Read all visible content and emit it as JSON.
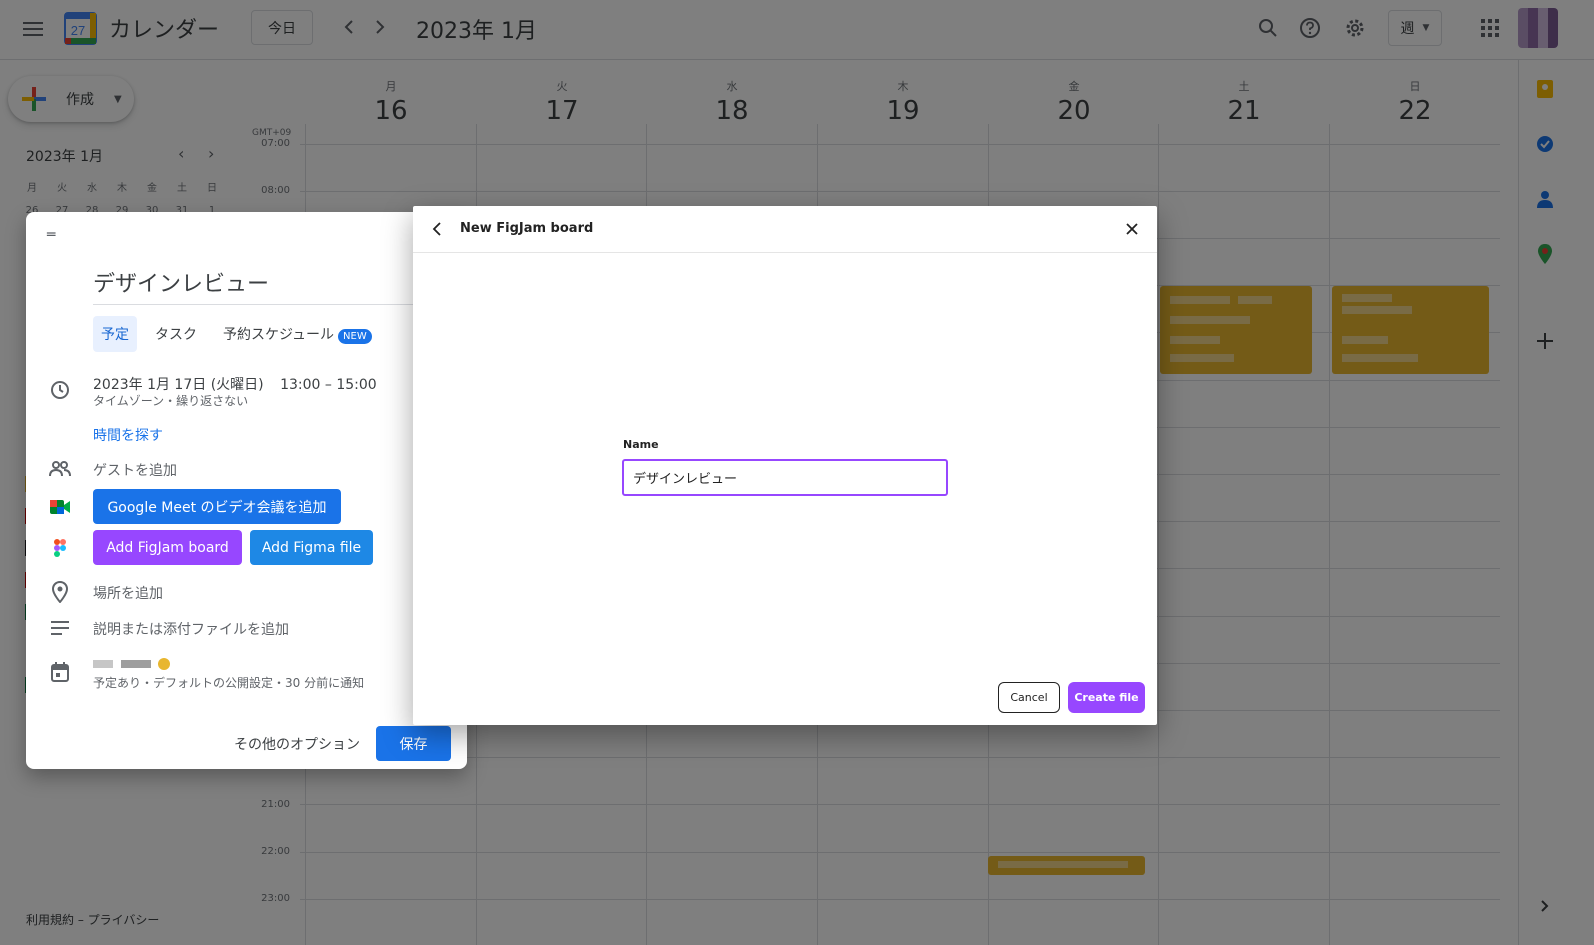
{
  "header": {
    "app_title": "カレンダー",
    "logo_number": "27",
    "today_label": "今日",
    "month_title": "2023年 1月",
    "view_label": "週"
  },
  "create": {
    "label": "作成"
  },
  "mini_calendar": {
    "title": "2023年 1月",
    "weekdays": [
      "月",
      "火",
      "水",
      "木",
      "金",
      "土",
      "日"
    ],
    "first_row": [
      "26",
      "27",
      "28",
      "29",
      "30",
      "31",
      "1"
    ]
  },
  "footer": {
    "links": "利用規約 – プライバシー"
  },
  "grid": {
    "timezone": "GMT+09",
    "days": [
      {
        "dow": "月",
        "num": "16"
      },
      {
        "dow": "火",
        "num": "17"
      },
      {
        "dow": "水",
        "num": "18"
      },
      {
        "dow": "木",
        "num": "19"
      },
      {
        "dow": "金",
        "num": "20"
      },
      {
        "dow": "土",
        "num": "21"
      },
      {
        "dow": "日",
        "num": "22"
      }
    ],
    "hours": [
      "07:00",
      "08:00",
      "21:00",
      "22:00",
      "23:00"
    ],
    "event_color": "#e8b62f"
  },
  "panel": {
    "title": "デザインレビュー",
    "tabs": {
      "event": "予定",
      "task": "タスク",
      "schedule": "予約スケジュール",
      "new_badge": "NEW"
    },
    "date": "2023年 1月 17日 (火曜日)",
    "time": "13:00 – 15:00",
    "recurrence": "タイムゾーン・繰り返さない",
    "find_time": "時間を探す",
    "guests": "ゲストを追加",
    "meet_button": "Google Meet のビデオ会議を追加",
    "figjam_button": "Add FigJam board",
    "figma_button": "Add Figma file",
    "location": "場所を追加",
    "description": "説明または添付ファイルを追加",
    "visibility": "予定あり・デフォルトの公開設定・30 分前に通知",
    "more_options": "その他のオプション",
    "save": "保存"
  },
  "dialog": {
    "title": "New FigJam board",
    "name_label": "Name",
    "name_value": "デザインレビュー",
    "cancel": "Cancel",
    "create": "Create file",
    "accent": "#9747ff"
  }
}
